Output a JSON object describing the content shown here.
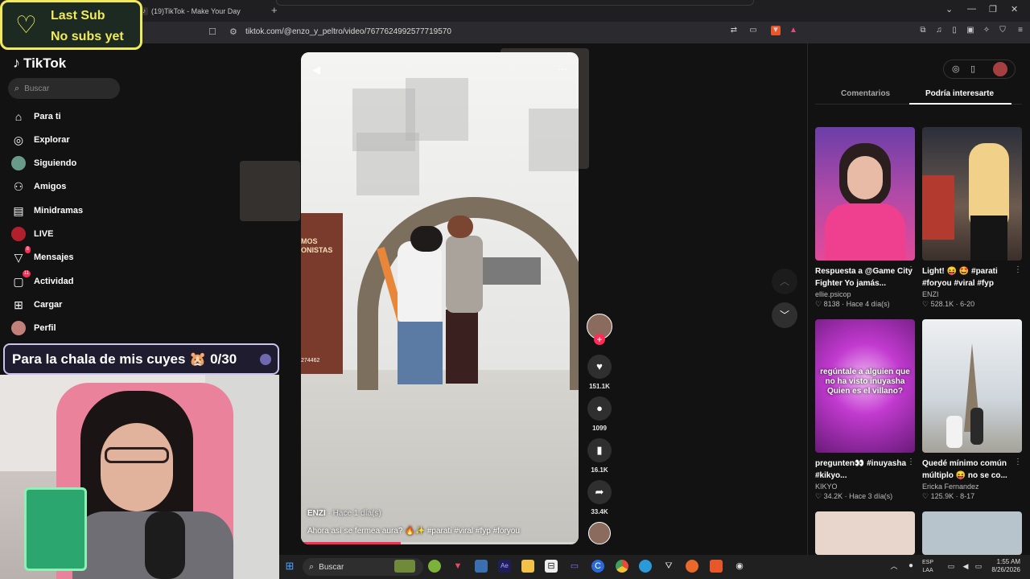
{
  "browser": {
    "tab_title": "(19)TikTok - Make Your Day",
    "url": "tiktok.com/@enzo_y_peltro/video/7677624992577719570"
  },
  "overlay": {
    "last_sub_title": "Last Sub",
    "last_sub_value": "No subs yet",
    "goal_text": "Para la chala de mis cuyes 🐹 0/30"
  },
  "sidebar": {
    "logo": "TikTok",
    "search_placeholder": "Buscar",
    "items": [
      {
        "label": "Para ti",
        "icon": "home-icon"
      },
      {
        "label": "Explorar",
        "icon": "compass-icon"
      },
      {
        "label": "Siguiendo",
        "icon": "following-avatar"
      },
      {
        "label": "Amigos",
        "icon": "friends-icon"
      },
      {
        "label": "Minidramas",
        "icon": "film-icon"
      },
      {
        "label": "LIVE",
        "icon": "live-icon"
      },
      {
        "label": "Mensajes",
        "icon": "send-icon",
        "badge": "8"
      },
      {
        "label": "Actividad",
        "icon": "bell-icon",
        "badge": "11"
      },
      {
        "label": "Cargar",
        "icon": "plus-square-icon"
      },
      {
        "label": "Perfil",
        "icon": "profile-avatar"
      }
    ]
  },
  "video": {
    "banner_text": "MOS\nONISTAS",
    "banner_number": "274462",
    "author": "ENZI",
    "time": " · Hace 1 día(s)",
    "caption": "Ahora así se fermea aura? 🔥✨ #parati #viral #fyp #foryou",
    "progress": 0.36,
    "likes": "151.1K",
    "comments": "1099",
    "saves": "16.1K",
    "shares": "33.4K"
  },
  "right_panel": {
    "tabs": [
      "Comentarios",
      "Podría interesarte"
    ],
    "active_tab": 1,
    "cards": [
      {
        "title": "Respuesta a @Game City Fighter Yo jamás...",
        "author": "ellie.psicop",
        "stats": "♡ 8138 · Hace 4 día(s)",
        "overlay": ""
      },
      {
        "title": "Light! 😝 🤩 #parati #foryou #viral #fyp",
        "author": "ENZI",
        "stats": "♡ 528.1K · 6-20",
        "overlay": ""
      },
      {
        "title": "pregunten👀 #inuyasha #kikyo...",
        "author": "KIKYO",
        "stats": "♡ 34.2K · Hace 3 día(s)",
        "overlay": "regúntale a alguien que no ha visto inuyasha Quien es el villano?"
      },
      {
        "title": "Quedé mínimo común múltiplo 😝 no se co...",
        "author": "Ericka Fernandez",
        "stats": "♡ 125.9K · 8-17",
        "overlay": ""
      }
    ]
  },
  "taskbar": {
    "search_placeholder": "Buscar",
    "lang_top": "ESP",
    "lang_bottom": "LAA",
    "time": "1:55 AM",
    "date": "8/26/2026"
  },
  "colors": {
    "accent": "#fe2c55",
    "overlay_yellow": "#f0ea5c",
    "background": "#121212"
  }
}
